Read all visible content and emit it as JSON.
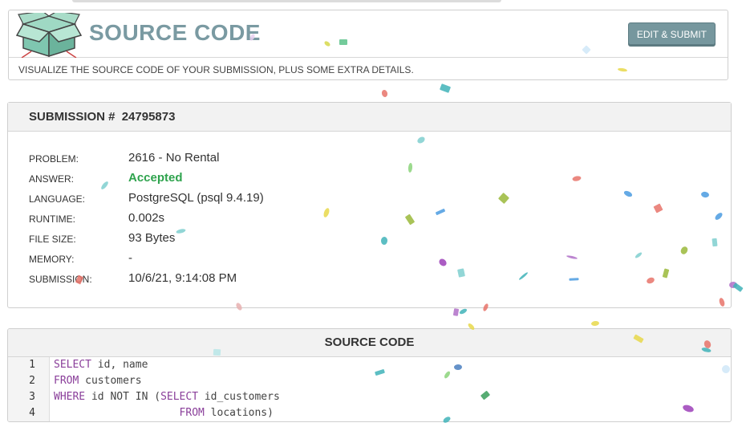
{
  "header": {
    "title": "SOURCE CODE",
    "edit_button": "EDIT & SUBMIT",
    "subtitle": "VISUALIZE THE SOURCE CODE OF YOUR SUBMISSION, PLUS SOME EXTRA DETAILS."
  },
  "submission": {
    "heading_prefix": "SUBMISSION #",
    "number": "24795873",
    "details": [
      {
        "label": "PROBLEM:",
        "value": "2616 - No Rental"
      },
      {
        "label": "ANSWER:",
        "value": "Accepted"
      },
      {
        "label": "LANGUAGE:",
        "value": "PostgreSQL (psql 9.4.19)"
      },
      {
        "label": "RUNTIME:",
        "value": "0.002s"
      },
      {
        "label": "FILE SIZE:",
        "value": "93 Bytes"
      },
      {
        "label": "MEMORY:",
        "value": "-"
      },
      {
        "label": "SUBMISSION:",
        "value": "10/6/21, 9:14:08 PM"
      }
    ]
  },
  "source": {
    "heading": "SOURCE CODE",
    "lines": [
      {
        "num": "1",
        "parts": [
          {
            "kw": true,
            "t": "SELECT"
          },
          {
            "kw": false,
            "t": " id, name"
          }
        ]
      },
      {
        "num": "2",
        "parts": [
          {
            "kw": true,
            "t": "FROM"
          },
          {
            "kw": false,
            "t": " customers"
          }
        ]
      },
      {
        "num": "3",
        "parts": [
          {
            "kw": true,
            "t": "WHERE"
          },
          {
            "kw": false,
            "t": " id NOT IN ("
          },
          {
            "kw": true,
            "t": "SELECT"
          },
          {
            "kw": false,
            "t": " id_customers"
          }
        ]
      },
      {
        "num": "4",
        "parts": [
          {
            "kw": false,
            "t": "                    "
          },
          {
            "kw": true,
            "t": "FROM"
          },
          {
            "kw": false,
            "t": " locations)"
          }
        ]
      }
    ]
  },
  "colors": {
    "accent": "#76979e",
    "accepted": "#2ea34d",
    "keyword": "#8a3f9a"
  }
}
